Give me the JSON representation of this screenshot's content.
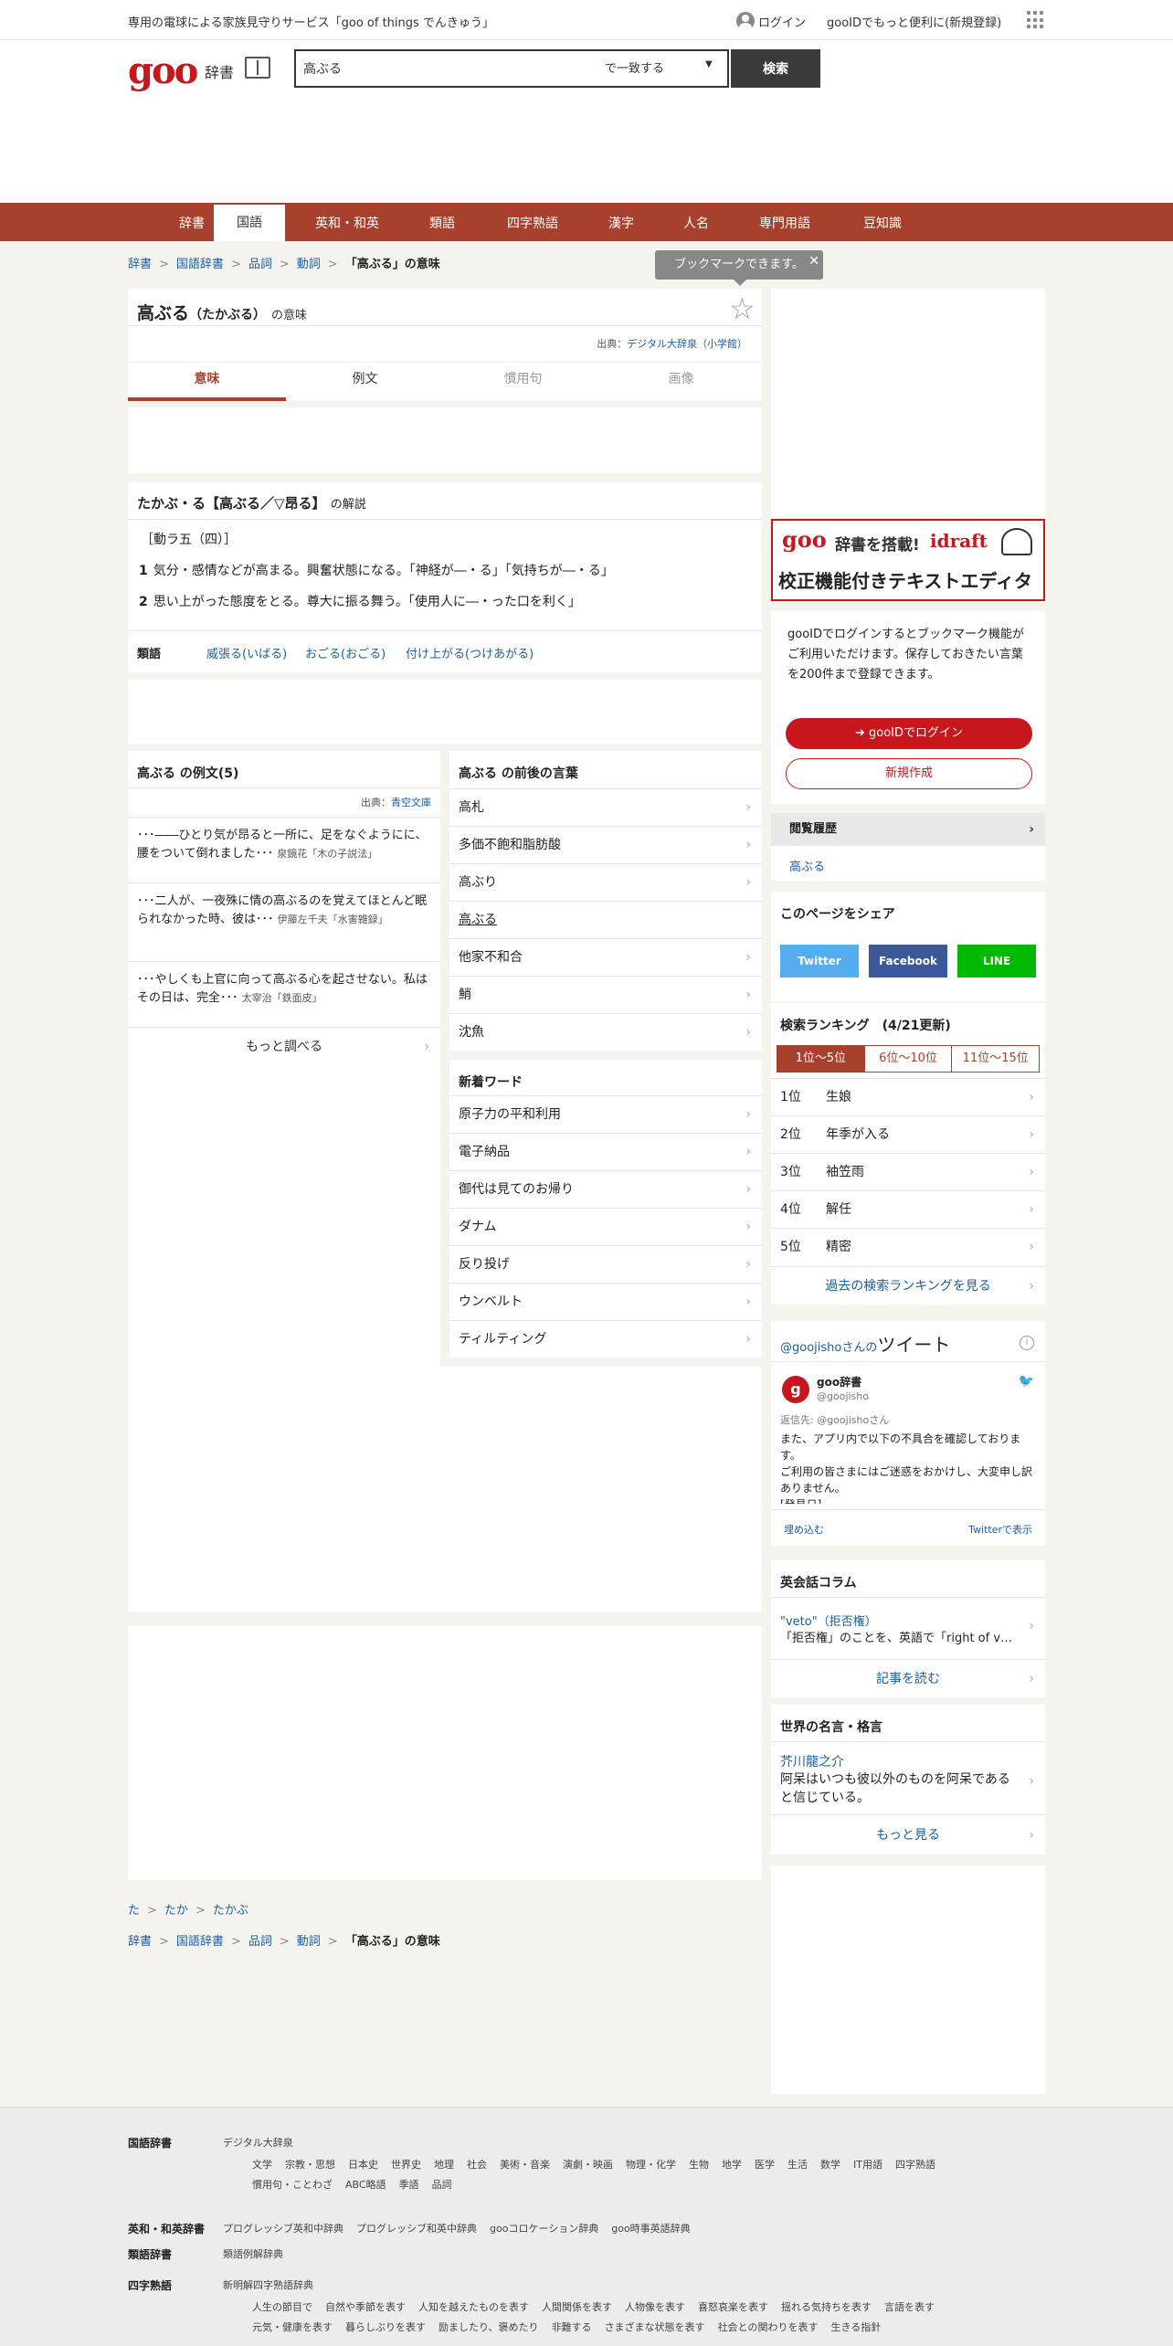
{
  "topbar": {
    "promo": "専用の電球による家族見守りサービス「goo of things でんきゅう」",
    "login": "ログイン",
    "register": "gooIDでもっと便利に(新規登録)"
  },
  "header": {
    "logo": "goo",
    "dict_label": "辞書",
    "search_value": "高ぶる",
    "match_option": "で一致する",
    "search_button": "検索"
  },
  "nav": {
    "tabs": [
      "辞書",
      "国語",
      "英和・和英",
      "類語",
      "四字熟語",
      "漢字",
      "人名",
      "専門用語",
      "豆知識"
    ],
    "active_index": 1
  },
  "breadcrumb": {
    "items": [
      "辞書",
      "国語辞書",
      "品詞",
      "動詞"
    ],
    "current": "「高ぶる」の意味"
  },
  "tooltip": {
    "text": "ブックマークできます。",
    "close": "✕"
  },
  "word": {
    "title": "高ぶる",
    "reading": "（たかぶる）",
    "suffix": "の意味",
    "source_label": "出典：",
    "source": "デジタル大辞泉（小学館）",
    "tabs": [
      "意味",
      "例文",
      "慣用句",
      "画像"
    ]
  },
  "definition": {
    "heading": "たかぶ・る【高ぶる／▽昂る】",
    "heading_suffix": "の解説",
    "pos": "［動ラ五（四）］",
    "lines": [
      {
        "num": "1",
        "text": "気分・感情などが高まる。興奮状態になる。「神経が―・る」「気持ちが―・る」"
      },
      {
        "num": "2",
        "text": "思い上がった態度をとる。尊大に振る舞う。「使用人に―・った口を利く」"
      }
    ],
    "related_label": "類語",
    "related": [
      "威張る(いばる)",
      "おごる(おごる)",
      "付け上がる(つけあがる)"
    ]
  },
  "examples": {
    "title": "高ぶる の例文(5)",
    "source_label": "出典：",
    "source": "青空文庫",
    "items": [
      {
        "text": "･･･――ひとり気が昂ると一所に、足をなぐようにに、腰をついて倒れました･･･",
        "author": "泉鏡花「木の子説法」"
      },
      {
        "text": "･･･二人が、一夜殊に情の高ぶるのを覚えてほとんど眠られなかった時、彼は･･･",
        "author": "伊藤左千夫「水害雑録」"
      },
      {
        "text": "･･･やしくも上官に向って高ぶる心を起させない。私はその日は、完全･･･",
        "author": "太宰治「鉄面皮」"
      }
    ],
    "more": "もっと調べる"
  },
  "before_after": {
    "title": "高ぶる の前後の言葉",
    "items": [
      "高札",
      "多価不飽和脂肪酸",
      "高ぶり",
      "高ぶる",
      "他家不和合",
      "鮹",
      "沈魚"
    ]
  },
  "new_words": {
    "title": "新着ワード",
    "items": [
      "原子力の平和利用",
      "電子納品",
      "御代は見てのお帰り",
      "ダナム",
      "反り投げ",
      "ウンベルト",
      "ティルティング"
    ]
  },
  "idraft": {
    "logo": "goo",
    "line1": "辞書を搭載!",
    "brand": "idraft",
    "line2": "校正機能付きテキストエディタ"
  },
  "login_box": {
    "text": "gooIDでログインするとブックマーク機能がご利用いただけます。保存しておきたい言葉を200件まで登録できます。",
    "login_button": "gooIDでログイン",
    "signup_button": "新規作成"
  },
  "history": {
    "title": "閲覧履歴",
    "items": [
      "高ぶる"
    ]
  },
  "share": {
    "title": "このページをシェア",
    "buttons": [
      "Twitter",
      "Facebook",
      "LINE"
    ],
    "colors": [
      "#55acee",
      "#3b5998",
      "#00b900"
    ]
  },
  "ranking": {
    "title": "検索ランキング　(4/21更新)",
    "tabs": [
      "1位～5位",
      "6位～10位",
      "11位～15位"
    ],
    "items": [
      {
        "rank": "1位",
        "word": "生娘"
      },
      {
        "rank": "2位",
        "word": "年季が入る"
      },
      {
        "rank": "3位",
        "word": "袖笠雨"
      },
      {
        "rank": "4位",
        "word": "解任"
      },
      {
        "rank": "5位",
        "word": "精密"
      }
    ],
    "more": "過去の検索ランキングを見る"
  },
  "tweet": {
    "handle_head": "@goojishoさんの",
    "head_big": "ツイート",
    "name": "goo辞書",
    "handle": "@goojisho",
    "reply": "返信先: @goojishoさん",
    "body": "また、アプリ内で以下の不具合を確認しております。\nご利用の皆さまにはご迷惑をおかけし、大変申し訳ありません。\n[発見日]",
    "embed": "埋め込む",
    "view": "Twitterで表示"
  },
  "column": {
    "title": "英会話コラム",
    "item_title": "\"veto\"（拒否権）",
    "item_desc": "「拒否権」のことを、英語で「right of v…",
    "more": "記事を読む"
  },
  "quote": {
    "title": "世界の名言・格言",
    "author": "芥川龍之介",
    "text": "阿呆はいつも彼以外のものを阿呆であると信じている。",
    "more": "もっと見る"
  },
  "bottom": {
    "kana": [
      "た",
      "たか",
      "たかぶ"
    ]
  },
  "footer": {
    "kokugo_label": "国語辞書",
    "kokugo_main": "デジタル大辞泉",
    "kokugo_cats1": [
      "文学",
      "宗教・思想",
      "日本史",
      "世界史",
      "地理",
      "社会",
      "美術・音楽",
      "演劇・映画",
      "物理・化学",
      "生物",
      "地学",
      "医学",
      "生活",
      "数学",
      "IT用語",
      "四字熟語"
    ],
    "kokugo_cats2": [
      "慣用句・ことわざ",
      "ABC略語",
      "季語",
      "品詞"
    ],
    "eiwa_label": "英和・和英辞書",
    "eiwa_items": [
      "プログレッシブ英和中辞典",
      "プログレッシブ和英中辞典",
      "gooコロケーション辞典",
      "goo時事英語辞典"
    ],
    "ruigo_label": "類語辞書",
    "ruigo_items": [
      "類語例解辞典"
    ],
    "yoji_label": "四字熟語",
    "yoji_main": "新明解四字熟語辞典",
    "yoji_cats1": [
      "人生の節目で",
      "自然や季節を表す",
      "人知を越えたものを表す",
      "人間関係を表す",
      "人物像を表す",
      "喜怒哀楽を表す",
      "揺れる気持ちを表す",
      "言語を表す"
    ],
    "yoji_cats2": [
      "元気・健康を表す",
      "暮らしぶりを表す",
      "励ましたり、褒めたり",
      "非難する",
      "さまざまな状態を表す",
      "社会との関わりを表す",
      "生きる指針"
    ]
  }
}
